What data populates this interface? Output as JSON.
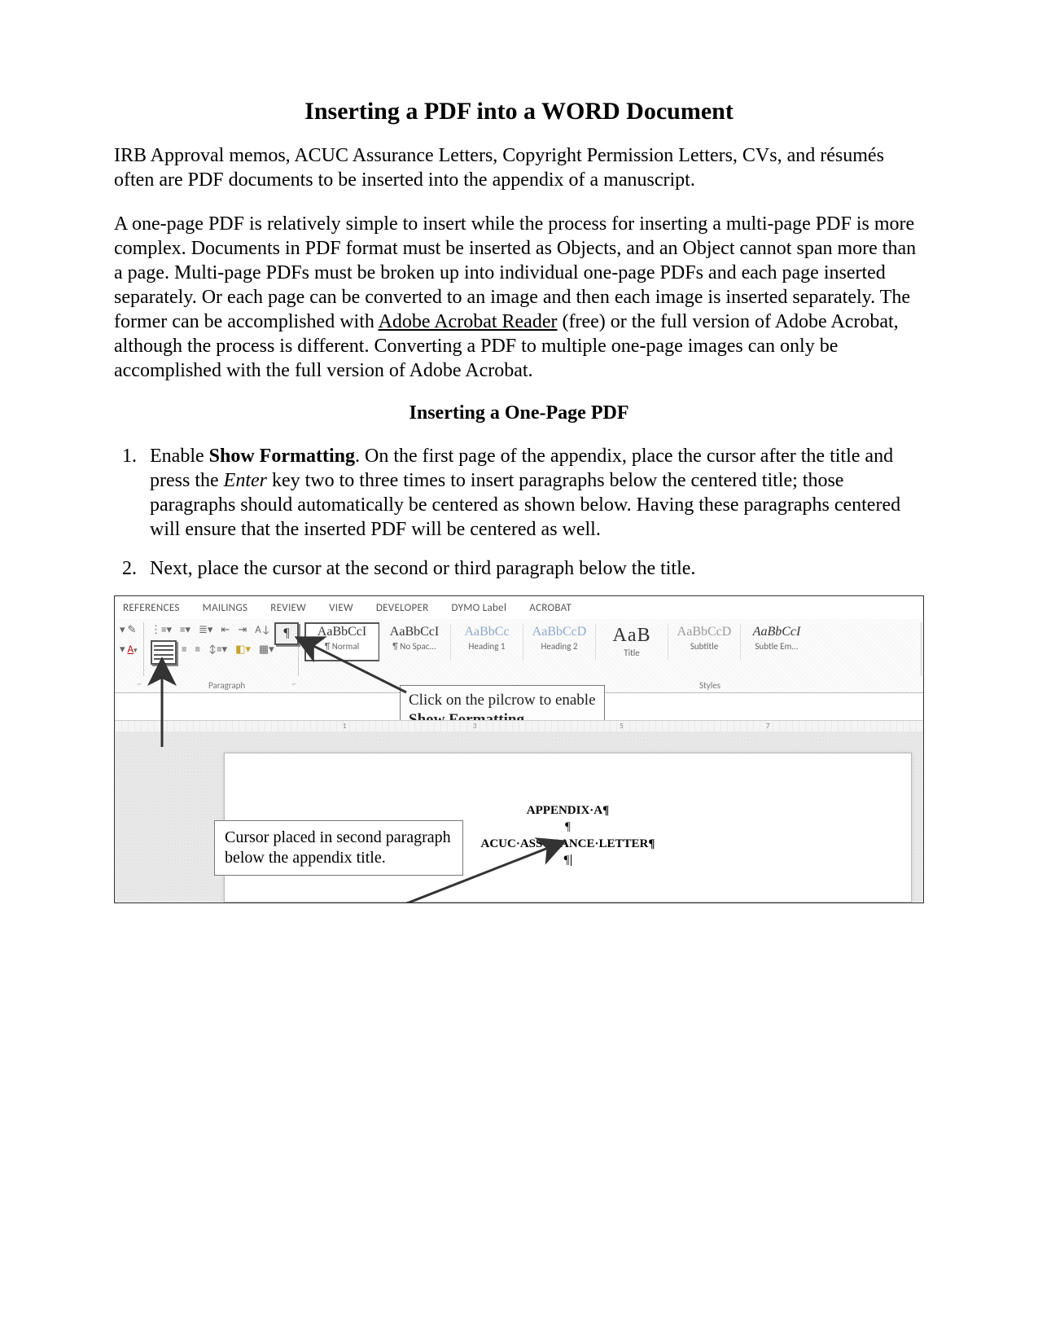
{
  "title": "Inserting a PDF into a WORD Document",
  "intro1": "IRB Approval memos, ACUC Assurance Letters, Copyright Permission Letters, CVs, and résumés often are PDF documents to be inserted into the appendix of a manuscript.",
  "intro2_a": "A one-page PDF is relatively simple to insert while the process for inserting a multi-page PDF is more complex. Documents in PDF format must be inserted as Objects, and an Object cannot span more than a page. Multi-page PDFs must be broken up into individual one-page PDFs and each page inserted separately. Or each page can be converted to an image and then each image is inserted separately. The former can be accomplished with ",
  "intro2_link": "Adobe Acrobat Reader",
  "intro2_b": " (free) or the full version of Adobe Acrobat, although the process is different. Converting a PDF to multiple one-page images can only be accomplished with the full version of Adobe Acrobat.",
  "section1": "Inserting a One-Page PDF",
  "step1_a": "Enable ",
  "step1_bold": "Show Formatting",
  "step1_b": ". On the first page of the appendix, place the cursor after the title and press the ",
  "step1_italic": "Enter",
  "step1_c": " key two to three times to insert paragraphs below the centered title; those paragraphs should automatically be centered as shown below. Having these paragraphs centered will ensure that the inserted PDF will be centered as well.",
  "step2": "Next, place the cursor at the second or third paragraph below the title.",
  "ribbonTabs": [
    "REFERENCES",
    "MAILINGS",
    "REVIEW",
    "VIEW",
    "DEVELOPER",
    "DYMO Label",
    "ACROBAT"
  ],
  "groupParagraph": "Paragraph",
  "groupStyles": "Styles",
  "styles": [
    {
      "preview": "AaBbCcI",
      "name": "¶ Normal",
      "cls": ""
    },
    {
      "preview": "AaBbCcI",
      "name": "¶ No Spac...",
      "cls": ""
    },
    {
      "preview": "AaBbCc",
      "name": "Heading 1",
      "cls": "h1"
    },
    {
      "preview": "AaBbCcD",
      "name": "Heading 2",
      "cls": "h2"
    },
    {
      "preview": "AaB",
      "name": "Title",
      "cls": "title"
    },
    {
      "preview": "AaBbCcD",
      "name": "Subtitle",
      "cls": "sub"
    },
    {
      "preview": "AaBbCcI",
      "name": "Subtle Em...",
      "cls": "se"
    }
  ],
  "docLine1": "APPENDIX·A¶",
  "docLine2": "¶",
  "docLine3": "ACUC·ASSURANCE·LETTER¶",
  "docLine4": "¶",
  "callout1_a": "Click on the pilcrow to enable ",
  "callout1_b": "Show Formatting",
  "callout2": "Cursor placed in second paragraph below the appendix title.",
  "rulerMarks": {
    "m1": "1",
    "m3": "3",
    "m5": "5",
    "m7": "7"
  }
}
